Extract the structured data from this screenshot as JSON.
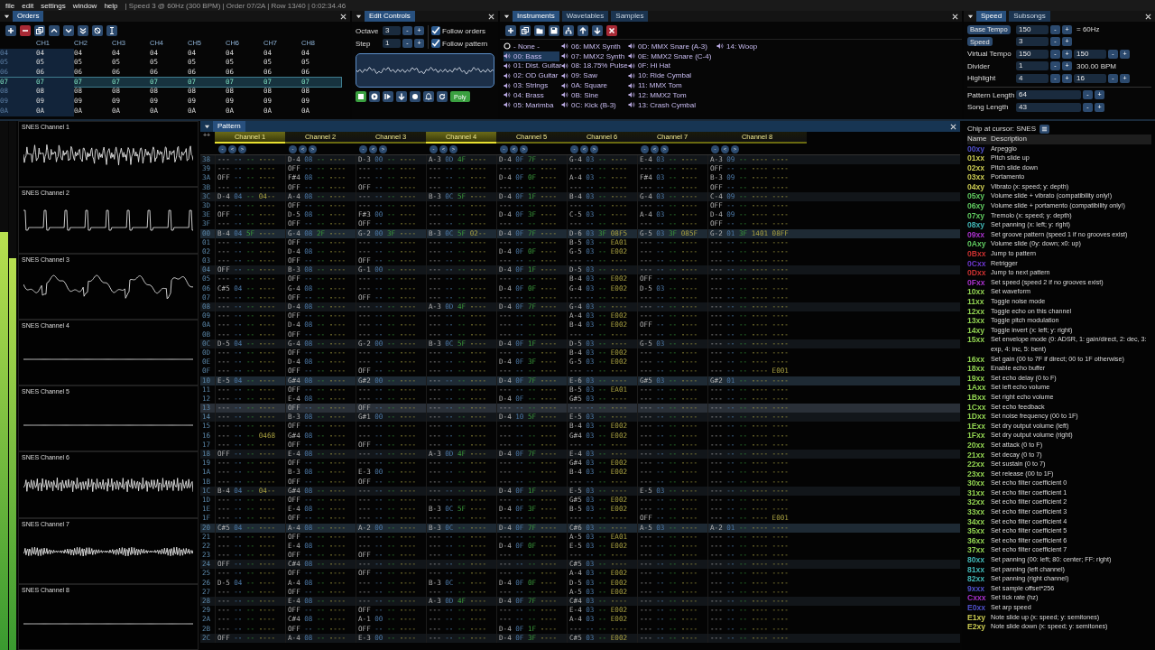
{
  "menu": [
    "file",
    "edit",
    "settings",
    "window",
    "help"
  ],
  "status": "| Speed 3 @ 60Hz (300 BPM) | Order 07/2A | Row 13/40 | 0:02:34.46",
  "orders": {
    "tabs": [
      {
        "label": "Orders",
        "selected": true
      }
    ],
    "toolbar": [
      {
        "kind": "add"
      },
      {
        "kind": "remove"
      },
      {
        "kind": "duplicate"
      },
      {
        "kind": "up"
      },
      {
        "kind": "down"
      },
      {
        "kind": "down-double"
      },
      {
        "kind": "swap"
      },
      {
        "kind": "cursor"
      }
    ],
    "columns": [
      "CH1",
      "CH2",
      "CH3",
      "CH4",
      "CH5",
      "CH6",
      "CH7",
      "CH8"
    ],
    "rows": [
      {
        "label": "04",
        "values": [
          "04",
          "04",
          "04",
          "04",
          "04",
          "04",
          "04",
          "04"
        ],
        "selected": false
      },
      {
        "label": "05",
        "values": [
          "05",
          "05",
          "05",
          "05",
          "05",
          "05",
          "05",
          "05"
        ],
        "selected": false
      },
      {
        "label": "06",
        "values": [
          "06",
          "06",
          "06",
          "06",
          "06",
          "06",
          "06",
          "06"
        ],
        "selected": false
      },
      {
        "label": "07",
        "values": [
          "07",
          "07",
          "07",
          "07",
          "07",
          "07",
          "07",
          "07"
        ],
        "selected": true
      },
      {
        "label": "08",
        "values": [
          "08",
          "08",
          "08",
          "08",
          "08",
          "08",
          "08",
          "08"
        ],
        "selected": false
      },
      {
        "label": "09",
        "values": [
          "09",
          "09",
          "09",
          "09",
          "09",
          "09",
          "09",
          "09"
        ],
        "selected": false
      },
      {
        "label": "0A",
        "values": [
          "0A",
          "0A",
          "0A",
          "0A",
          "0A",
          "0A",
          "0A",
          "0A"
        ],
        "selected": false
      }
    ]
  },
  "edit_controls": {
    "tabs": [
      {
        "label": "Edit Controls",
        "selected": true
      }
    ],
    "fields": [
      {
        "label": "Octave",
        "value": "3",
        "buttons": [
          "-",
          "+"
        ]
      },
      {
        "label": "Step",
        "value": "1",
        "buttons": [
          "-",
          "+"
        ]
      }
    ],
    "toggles": [
      {
        "label": "Follow orders",
        "checked": true
      },
      {
        "label": "Follow pattern",
        "checked": true
      }
    ],
    "transport": [
      {
        "kind": "stop",
        "active": true
      },
      {
        "kind": "play",
        "active": false
      },
      {
        "kind": "step",
        "active": false
      },
      {
        "kind": "down",
        "active": false
      },
      {
        "kind": "record",
        "active": false
      },
      {
        "kind": "bell",
        "active": false
      },
      {
        "kind": "repeat",
        "active": false
      }
    ],
    "poly": {
      "label": "Poly",
      "on": true
    }
  },
  "instruments": {
    "tabs": [
      {
        "label": "Instruments",
        "selected": true
      },
      {
        "label": "Wavetables",
        "selected": false
      },
      {
        "label": "Samples",
        "selected": false
      }
    ],
    "toolbar": [
      {
        "kind": "add"
      },
      {
        "kind": "duplicate"
      },
      {
        "kind": "open"
      },
      {
        "kind": "save"
      },
      {
        "kind": "tree"
      },
      {
        "kind": "up-arrow"
      },
      {
        "kind": "down-arrow"
      },
      {
        "kind": "delete"
      }
    ],
    "items": [
      {
        "kind": "none",
        "label": "- None -",
        "selected": false
      },
      {
        "kind": "instrument",
        "label": "00: Bass",
        "selected": true
      },
      {
        "kind": "instrument",
        "label": "01: Dist. Guitar",
        "selected": false
      },
      {
        "kind": "instrument",
        "label": "02: OD Guitar",
        "selected": false
      },
      {
        "kind": "instrument",
        "label": "03: Strings",
        "selected": false
      },
      {
        "kind": "instrument",
        "label": "04: Brass",
        "selected": false
      },
      {
        "kind": "instrument",
        "label": "05: Marimba",
        "selected": false
      },
      {
        "kind": "instrument",
        "label": "06: MMX Synth",
        "selected": false
      },
      {
        "kind": "instrument",
        "label": "07: MMX2 Synth",
        "selected": false
      },
      {
        "kind": "instrument",
        "label": "08: 18.75% Pulse",
        "selected": false
      },
      {
        "kind": "instrument",
        "label": "09: Saw",
        "selected": false
      },
      {
        "kind": "instrument",
        "label": "0A: Square",
        "selected": false
      },
      {
        "kind": "instrument",
        "label": "0B: Sine",
        "selected": false
      },
      {
        "kind": "instrument",
        "label": "0C: Kick (B-3)",
        "selected": false
      },
      {
        "kind": "instrument",
        "label": "0D: MMX Snare (A-3)",
        "selected": false
      },
      {
        "kind": "instrument",
        "label": "0E: MMX2 Snare (C-4)",
        "selected": false
      },
      {
        "kind": "instrument",
        "label": "0F: Hi Hat",
        "selected": false
      },
      {
        "kind": "instrument",
        "label": "10: Ride Cymbal",
        "selected": false
      },
      {
        "kind": "instrument",
        "label": "11: MMX Tom",
        "selected": false
      },
      {
        "kind": "instrument",
        "label": "12: MMX2 Tom",
        "selected": false
      },
      {
        "kind": "instrument",
        "label": "13: Crash Cymbal",
        "selected": false
      },
      {
        "kind": "instrument",
        "label": "14: Woop",
        "selected": false
      }
    ]
  },
  "speed": {
    "tabs": [
      {
        "label": "Speed",
        "selected": true
      },
      {
        "label": "Subsongs",
        "selected": false
      }
    ],
    "rows": [
      {
        "kind": "button",
        "label": "Base Tempo",
        "value": "150",
        "buttons": [
          "-",
          "+"
        ],
        "note": "= 60Hz"
      },
      {
        "kind": "button",
        "label": "Speed",
        "value": "3",
        "buttons": [
          "-",
          "+"
        ]
      },
      {
        "kind": "text",
        "label": "Virtual Tempo",
        "value": "150",
        "buttons": [
          "-",
          "+"
        ],
        "value2": "150",
        "buttons2": [
          "-",
          "+"
        ]
      },
      {
        "kind": "text",
        "label": "Divider",
        "value": "1",
        "buttons": [
          "-",
          "+"
        ],
        "note": "300.00 BPM"
      },
      {
        "kind": "text",
        "label": "Highlight",
        "value": "4",
        "buttons": [
          "-",
          "+"
        ],
        "value2": "16",
        "buttons2": [
          "-",
          "+"
        ]
      }
    ],
    "lengths": [
      {
        "label": "Pattern Length",
        "value": "64",
        "buttons": [
          "-",
          "+"
        ]
      },
      {
        "label": "Song Length",
        "value": "43",
        "buttons": [
          "-",
          "+"
        ]
      }
    ]
  },
  "vu_meters": [
    {
      "level": 0.79
    },
    {
      "level": 0.74
    }
  ],
  "oscilloscopes": [
    {
      "title": "SNES Channel 1"
    },
    {
      "title": "SNES Channel 2"
    },
    {
      "title": "SNES Channel 3"
    },
    {
      "title": "SNES Channel 4"
    },
    {
      "title": "SNES Channel 5"
    },
    {
      "title": "SNES Channel 6"
    },
    {
      "title": "SNES Channel 7"
    },
    {
      "title": "SNES Channel 8"
    }
  ],
  "pattern": {
    "tabs": [
      {
        "label": "Pattern",
        "selected": true
      }
    ],
    "corner": "++",
    "channels": [
      {
        "name": "Channel 1",
        "active": true,
        "buttons": [
          "-",
          "<",
          ">"
        ]
      },
      {
        "name": "Channel 2",
        "active": false,
        "buttons": [
          "-",
          "<",
          ">"
        ]
      },
      {
        "name": "Channel 3",
        "active": false,
        "buttons": [
          "-",
          "<",
          ">"
        ]
      },
      {
        "name": "Channel 4",
        "active": true,
        "buttons": [
          "-",
          "<",
          ">"
        ]
      },
      {
        "name": "Channel 5",
        "active": false,
        "buttons": [
          "-",
          "<",
          ">"
        ]
      },
      {
        "name": "Channel 6",
        "active": false,
        "buttons": [
          "-",
          "<",
          ">"
        ]
      },
      {
        "name": "Channel 7",
        "active": false,
        "buttons": [
          "-",
          "<",
          ">"
        ]
      },
      {
        "name": "Channel 8",
        "active": false,
        "buttons": [
          "-",
          "<",
          ">"
        ]
      }
    ],
    "rows": [
      {
        "label": "38",
        "selected": false,
        "cells": [
          "--- -- -- ----",
          "D-4 08 -- ----",
          "D-3 00 -- ----",
          "A-3 0D 4F ----",
          "D-4 0F 7F ----",
          "G-4 03 -- ----",
          "E-4 03 -- ----",
          "A-3 09 -- ---- ----"
        ]
      },
      {
        "label": "39",
        "selected": false,
        "cells": [
          "--- -- -- ----",
          "OFF -- -- ----",
          "--- -- -- ----",
          "--- -- -- ----",
          "--- -- -- ----",
          "--- -- -- ----",
          "--- -- -- ----",
          "OFF -- -- ---- ----"
        ]
      },
      {
        "label": "3A",
        "selected": false,
        "cells": [
          "OFF -- -- ----",
          "F#4 08 -- ----",
          "--- -- -- ----",
          "--- -- -- ----",
          "D-4 0F 0F ----",
          "A-4 03 -- ----",
          "F#4 03 -- ----",
          "B-3 09 -- ---- ----"
        ]
      },
      {
        "label": "3B",
        "selected": false,
        "cells": [
          "--- -- -- ----",
          "OFF -- -- ----",
          "OFF -- -- ----",
          "--- -- -- ----",
          "--- -- -- ----",
          "--- -- -- ----",
          "--- -- -- ----",
          "OFF -- -- ---- ----"
        ]
      },
      {
        "label": "3C",
        "selected": false,
        "cells": [
          "D-4 04 -- 04--",
          "A-4 08 -- ----",
          "--- -- -- ----",
          "B-3 0C 5F ----",
          "D-4 0F 1F ----",
          "B-4 03 -- ----",
          "G-4 03 -- ----",
          "C-4 09 -- ---- ----"
        ]
      },
      {
        "label": "3D",
        "selected": false,
        "cells": [
          "--- -- -- ----",
          "OFF -- -- ----",
          "--- -- -- ----",
          "--- -- -- ----",
          "--- -- -- ----",
          "--- -- -- ----",
          "--- -- -- ----",
          "OFF -- -- ---- ----"
        ]
      },
      {
        "label": "3E",
        "selected": false,
        "cells": [
          "OFF -- -- ----",
          "D-5 08 -- ----",
          "F#3 00 -- ----",
          "--- -- -- ----",
          "D-4 0F 3F ----",
          "C-5 03 -- ----",
          "A-4 03 -- ----",
          "D-4 09 -- ---- ----"
        ]
      },
      {
        "label": "3F",
        "selected": false,
        "cells": [
          "--- -- -- ----",
          "OFF -- -- ----",
          "OFF -- -- ----",
          "--- -- -- ----",
          "--- -- -- ----",
          "--- -- -- ----",
          "--- -- -- ----",
          "OFF -- -- ---- ----"
        ]
      },
      {
        "label": "00",
        "selected": false,
        "cells": [
          "B-4 04 5F ----",
          "G-4 08 2F ----",
          "G-2 00 3F ----",
          "B-3 0C 5F 02--",
          "D-4 0F 7F ----",
          "D-6 03 3F 08F5",
          "G-5 03 3F 085F",
          "G-2 01 3F 1401 08FF"
        ]
      },
      {
        "label": "01",
        "selected": false,
        "cells": [
          "--- -- -- ----",
          "OFF -- -- ----",
          "--- -- -- ----",
          "--- -- -- ----",
          "--- -- -- ----",
          "B-5 03 -- EA01",
          "--- -- -- ----",
          "--- -- -- ---- ----"
        ]
      },
      {
        "label": "02",
        "selected": false,
        "cells": [
          "--- -- -- ----",
          "D-4 08 -- ----",
          "--- -- -- ----",
          "--- -- -- ----",
          "D-4 0F 0F ----",
          "G-5 03 -- E002",
          "--- -- -- ----",
          "--- -- -- ---- ----"
        ]
      },
      {
        "label": "03",
        "selected": false,
        "cells": [
          "--- -- -- ----",
          "OFF -- -- ----",
          "OFF -- -- ----",
          "--- -- -- ----",
          "--- -- -- ----",
          "--- -- -- ----",
          "--- -- -- ----",
          "--- -- -- ---- ----"
        ]
      },
      {
        "label": "04",
        "selected": false,
        "cells": [
          "OFF -- -- ----",
          "B-3 08 -- ----",
          "G-1 00 -- ----",
          "--- -- -- ----",
          "D-4 0F 1F ----",
          "D-5 03 -- ----",
          "--- -- -- ----",
          "--- -- -- ---- ----"
        ]
      },
      {
        "label": "05",
        "selected": false,
        "cells": [
          "--- -- -- ----",
          "OFF -- -- ----",
          "--- -- -- ----",
          "--- -- -- ----",
          "--- -- -- ----",
          "B-4 03 -- E002",
          "OFF -- -- ----",
          "--- -- -- ---- ----"
        ]
      },
      {
        "label": "06",
        "selected": false,
        "cells": [
          "C#5 04 -- ----",
          "G-4 08 -- ----",
          "--- -- -- ----",
          "--- -- -- ----",
          "D-4 0F 0F ----",
          "G-4 03 -- E002",
          "D-5 03 -- ----",
          "--- -- -- ---- ----"
        ]
      },
      {
        "label": "07",
        "selected": false,
        "cells": [
          "--- -- -- ----",
          "OFF -- -- ----",
          "OFF -- -- ----",
          "--- -- -- ----",
          "--- -- -- ----",
          "--- -- -- ----",
          "--- -- -- ----",
          "--- -- -- ---- ----"
        ]
      },
      {
        "label": "08",
        "selected": false,
        "cells": [
          "--- -- -- ----",
          "D-4 08 -- ----",
          "--- -- -- ----",
          "A-3 0D 4F ----",
          "D-4 0F 7F ----",
          "G-4 03 -- ----",
          "--- -- -- ----",
          "--- -- -- ---- ----"
        ]
      },
      {
        "label": "09",
        "selected": false,
        "cells": [
          "--- -- -- ----",
          "OFF -- -- ----",
          "--- -- -- ----",
          "--- -- -- ----",
          "--- -- -- ----",
          "A-4 03 -- E002",
          "--- -- -- ----",
          "--- -- -- ---- ----"
        ]
      },
      {
        "label": "0A",
        "selected": false,
        "cells": [
          "--- -- -- ----",
          "D-4 08 -- ----",
          "--- -- -- ----",
          "--- -- -- ----",
          "--- -- -- ----",
          "B-4 03 -- E002",
          "OFF -- -- ----",
          "--- -- -- ---- ----"
        ]
      },
      {
        "label": "0B",
        "selected": false,
        "cells": [
          "--- -- -- ----",
          "OFF -- -- ----",
          "--- -- -- ----",
          "--- -- -- ----",
          "--- -- -- ----",
          "--- -- -- ----",
          "--- -- -- ----",
          "--- -- -- ---- ----"
        ]
      },
      {
        "label": "0C",
        "selected": false,
        "cells": [
          "D-5 04 -- ----",
          "G-4 08 -- ----",
          "G-2 00 -- ----",
          "B-3 0C 5F ----",
          "D-4 0F 1F ----",
          "D-5 03 -- ----",
          "G-5 03 -- ----",
          "--- -- -- ---- ----"
        ]
      },
      {
        "label": "0D",
        "selected": false,
        "cells": [
          "--- -- -- ----",
          "OFF -- -- ----",
          "--- -- -- ----",
          "--- -- -- ----",
          "--- -- -- ----",
          "B-4 03 -- E002",
          "--- -- -- ----",
          "--- -- -- ---- ----"
        ]
      },
      {
        "label": "0E",
        "selected": false,
        "cells": [
          "--- -- -- ----",
          "D-4 08 -- ----",
          "--- -- -- ----",
          "--- -- -- ----",
          "D-4 0F 3F ----",
          "G-5 03 -- E002",
          "--- -- -- ----",
          "--- -- -- ---- ----"
        ]
      },
      {
        "label": "0F",
        "selected": false,
        "cells": [
          "--- -- -- ----",
          "OFF -- -- ----",
          "OFF -- -- ----",
          "--- -- -- ----",
          "--- -- -- ----",
          "--- -- -- ----",
          "--- -- -- ----",
          "--- -- -- ---- E001"
        ]
      },
      {
        "label": "10",
        "selected": false,
        "cells": [
          "E-5 04 -- ----",
          "G#4 08 -- ----",
          "G#2 00 -- ----",
          "--- -- -- ----",
          "D-4 0F 7F ----",
          "E-6 03 -- ----",
          "G#5 03 -- ----",
          "G#2 01 -- ---- ----"
        ]
      },
      {
        "label": "11",
        "selected": false,
        "cells": [
          "--- -- -- ----",
          "OFF -- -- ----",
          "--- -- -- ----",
          "--- -- -- ----",
          "--- -- -- ----",
          "B-5 03 -- EA01",
          "--- -- -- ----",
          "--- -- -- ---- ----"
        ]
      },
      {
        "label": "12",
        "selected": false,
        "cells": [
          "--- -- -- ----",
          "E-4 08 -- ----",
          "--- -- -- ----",
          "--- -- -- ----",
          "D-4 0F -- ----",
          "G#5 03 -- ----",
          "--- -- -- ----",
          "--- -- -- ---- ----"
        ]
      },
      {
        "label": "13",
        "selected": true,
        "cells": [
          "--- -- -- ----",
          "OFF -- -- ----",
          "OFF -- -- ----",
          "--- -- -- ----",
          "--- -- -- ----",
          "--- -- -- ----",
          "--- -- -- ----",
          "--- -- -- ---- ----"
        ]
      },
      {
        "label": "14",
        "selected": false,
        "cells": [
          "--- -- -- ----",
          "B-3 08 -- ----",
          "G#1 00 -- ----",
          "--- -- -- ----",
          "D-4 10 5F ----",
          "E-5 03 -- ----",
          "--- -- -- ----",
          "--- -- -- ---- ----"
        ]
      },
      {
        "label": "15",
        "selected": false,
        "cells": [
          "--- -- -- ----",
          "OFF -- -- ----",
          "--- -- -- ----",
          "--- -- -- ----",
          "--- -- -- ----",
          "B-4 03 -- E002",
          "--- -- -- ----",
          "--- -- -- ---- ----"
        ]
      },
      {
        "label": "16",
        "selected": false,
        "cells": [
          "--- -- -- 0468",
          "G#4 08 -- ----",
          "--- -- -- ----",
          "--- -- -- ----",
          "--- -- -- ----",
          "G#4 03 -- E002",
          "--- -- -- ----",
          "--- -- -- ---- ----"
        ]
      },
      {
        "label": "17",
        "selected": false,
        "cells": [
          "--- -- -- ----",
          "OFF -- -- ----",
          "OFF -- -- ----",
          "--- -- -- ----",
          "--- -- -- ----",
          "--- -- -- ----",
          "--- -- -- ----",
          "--- -- -- ---- ----"
        ]
      },
      {
        "label": "18",
        "selected": false,
        "cells": [
          "OFF -- -- ----",
          "E-4 08 -- ----",
          "--- -- -- ----",
          "A-3 0D 4F ----",
          "D-4 0F 7F ----",
          "E-4 03 -- ----",
          "--- -- -- ----",
          "--- -- -- ---- ----"
        ]
      },
      {
        "label": "19",
        "selected": false,
        "cells": [
          "--- -- -- ----",
          "OFF -- -- ----",
          "--- -- -- ----",
          "--- -- -- ----",
          "--- -- -- ----",
          "G#4 03 -- E002",
          "--- -- -- ----",
          "--- -- -- ---- ----"
        ]
      },
      {
        "label": "1A",
        "selected": false,
        "cells": [
          "--- -- -- ----",
          "B-3 08 -- ----",
          "E-3 00 -- ----",
          "--- -- -- ----",
          "--- -- -- ----",
          "B-4 03 -- E002",
          "--- -- -- ----",
          "--- -- -- ---- ----"
        ]
      },
      {
        "label": "1B",
        "selected": false,
        "cells": [
          "--- -- -- ----",
          "OFF -- -- ----",
          "OFF -- -- ----",
          "--- -- -- ----",
          "--- -- -- ----",
          "--- -- -- ----",
          "--- -- -- ----",
          "--- -- -- ---- ----"
        ]
      },
      {
        "label": "1C",
        "selected": false,
        "cells": [
          "B-4 04 -- 04--",
          "G#4 08 -- ----",
          "--- -- -- ----",
          "--- -- -- ----",
          "D-4 0F 1F ----",
          "E-5 03 -- ----",
          "E-5 03 -- ----",
          "--- -- -- ---- ----"
        ]
      },
      {
        "label": "1D",
        "selected": false,
        "cells": [
          "--- -- -- ----",
          "OFF -- -- ----",
          "--- -- -- ----",
          "--- -- -- ----",
          "--- -- -- ----",
          "G#5 03 -- E002",
          "--- -- -- ----",
          "--- -- -- ---- ----"
        ]
      },
      {
        "label": "1E",
        "selected": false,
        "cells": [
          "--- -- -- ----",
          "E-4 08 -- ----",
          "--- -- -- ----",
          "B-3 0C 5F ----",
          "D-4 0F 3F ----",
          "B-5 03 -- E002",
          "--- -- -- ----",
          "--- -- -- ---- ----"
        ]
      },
      {
        "label": "1F",
        "selected": false,
        "cells": [
          "--- -- -- ----",
          "OFF -- -- ----",
          "--- -- -- ----",
          "--- -- -- ----",
          "--- -- -- ----",
          "--- -- -- ----",
          "OFF -- -- ----",
          "--- -- -- ---- E001"
        ]
      },
      {
        "label": "20",
        "selected": false,
        "cells": [
          "C#5 04 -- ----",
          "A-4 08 -- ----",
          "A-2 00 -- ----",
          "B-3 0C -- ----",
          "D-4 0F 7F ----",
          "C#6 03 -- ----",
          "A-5 03 -- ----",
          "A-2 01 -- ---- ----"
        ]
      },
      {
        "label": "21",
        "selected": false,
        "cells": [
          "--- -- -- ----",
          "OFF -- -- ----",
          "--- -- -- ----",
          "--- -- -- ----",
          "--- -- -- ----",
          "A-5 03 -- EA01",
          "--- -- -- ----",
          "--- -- -- ---- ----"
        ]
      },
      {
        "label": "22",
        "selected": false,
        "cells": [
          "--- -- -- ----",
          "E-4 08 -- ----",
          "--- -- -- ----",
          "--- -- -- ----",
          "D-4 0F 0F ----",
          "E-5 03 -- E002",
          "--- -- -- ----",
          "--- -- -- ---- ----"
        ]
      },
      {
        "label": "23",
        "selected": false,
        "cells": [
          "--- -- -- ----",
          "OFF -- -- ----",
          "OFF -- -- ----",
          "--- -- -- ----",
          "--- -- -- ----",
          "--- -- -- ----",
          "--- -- -- ----",
          "--- -- -- ---- ----"
        ]
      },
      {
        "label": "24",
        "selected": false,
        "cells": [
          "OFF -- -- ----",
          "C#4 08 -- ----",
          "--- -- -- ----",
          "--- -- -- ----",
          "--- -- -- ----",
          "C#5 03 -- ----",
          "--- -- -- ----",
          "--- -- -- ---- ----"
        ]
      },
      {
        "label": "25",
        "selected": false,
        "cells": [
          "--- -- -- ----",
          "OFF -- -- ----",
          "OFF -- -- ----",
          "--- -- -- ----",
          "--- -- -- ----",
          "A-4 03 -- E002",
          "--- -- -- ----",
          "--- -- -- ---- ----"
        ]
      },
      {
        "label": "26",
        "selected": false,
        "cells": [
          "D-5 04 -- ----",
          "A-4 08 -- ----",
          "--- -- -- ----",
          "B-3 0C -- ----",
          "D-4 0F 0F ----",
          "D-5 03 -- E002",
          "--- -- -- ----",
          "--- -- -- ---- ----"
        ]
      },
      {
        "label": "27",
        "selected": false,
        "cells": [
          "--- -- -- ----",
          "OFF -- -- ----",
          "--- -- -- ----",
          "--- -- -- ----",
          "--- -- -- ----",
          "A-5 03 -- E002",
          "--- -- -- ----",
          "--- -- -- ---- ----"
        ]
      },
      {
        "label": "28",
        "selected": false,
        "cells": [
          "--- -- -- ----",
          "E-4 08 -- ----",
          "--- -- -- ----",
          "A-3 0D 4F ----",
          "D-4 0F 7F ----",
          "C#4 03 -- ----",
          "--- -- -- ----",
          "--- -- -- ---- ----"
        ]
      },
      {
        "label": "29",
        "selected": false,
        "cells": [
          "--- -- -- ----",
          "OFF -- -- ----",
          "OFF -- -- ----",
          "--- -- -- ----",
          "--- -- -- ----",
          "E-4 03 -- E002",
          "--- -- -- ----",
          "--- -- -- ---- ----"
        ]
      },
      {
        "label": "2A",
        "selected": false,
        "cells": [
          "--- -- -- ----",
          "C#4 08 -- ----",
          "A-1 00 -- ----",
          "--- -- -- ----",
          "--- -- -- ----",
          "A-4 03 -- E002",
          "--- -- -- ----",
          "--- -- -- ---- ----"
        ]
      },
      {
        "label": "2B",
        "selected": false,
        "cells": [
          "--- -- -- ----",
          "OFF -- -- ----",
          "OFF -- -- ----",
          "--- -- -- ----",
          "D-4 0F 1F ----",
          "--- -- -- ----",
          "--- -- -- ----",
          "--- -- -- ---- ----"
        ]
      },
      {
        "label": "2C",
        "selected": false,
        "cells": [
          "OFF -- -- ----",
          "A-4 08 -- ----",
          "E-3 00 -- ----",
          "--- -- -- ----",
          "D-4 0F 3F ----",
          "C#5 03 -- E002",
          "--- -- -- ----",
          "--- -- -- ---- ----"
        ]
      }
    ]
  },
  "effects": {
    "chip": "Chip at cursor: SNES",
    "columns": [
      "Name",
      "Description"
    ],
    "items": [
      {
        "code": "00xy",
        "description": "Arpeggio",
        "color": "#4f4fc8"
      },
      {
        "code": "01xx",
        "description": "Pitch slide up",
        "color": "#c8c850"
      },
      {
        "code": "02xx",
        "description": "Pitch slide down",
        "color": "#c8c850"
      },
      {
        "code": "03xx",
        "description": "Portamento",
        "color": "#c8c850"
      },
      {
        "code": "04xy",
        "description": "Vibrato (x: speed; y: depth)",
        "color": "#c8c850"
      },
      {
        "code": "05xy",
        "description": "Volume slide + vibrato (compatibility only!)",
        "color": "#5fc85f"
      },
      {
        "code": "06xy",
        "description": "Volume slide + portamento (compatibility only!)",
        "color": "#5fc85f"
      },
      {
        "code": "07xy",
        "description": "Tremolo (x: speed; y: depth)",
        "color": "#5fc85f"
      },
      {
        "code": "08xy",
        "description": "Set panning (x: left; y: right)",
        "color": "#40b4b4"
      },
      {
        "code": "09xx",
        "description": "Set groove pattern (speed 1 if no grooves exist)",
        "color": "#a630c8"
      },
      {
        "code": "0Axy",
        "description": "Volume slide (0y: down; x0: up)",
        "color": "#5fc85f"
      },
      {
        "code": "0Bxx",
        "description": "Jump to pattern",
        "color": "#c83030"
      },
      {
        "code": "0Cxx",
        "description": "Retrigger",
        "color": "#6a35c8"
      },
      {
        "code": "0Dxx",
        "description": "Jump to next pattern",
        "color": "#c83030"
      },
      {
        "code": "0Fxx",
        "description": "Set speed (speed 2 if no grooves exist)",
        "color": "#a630c8"
      },
      {
        "code": "10xx",
        "description": "Set waveform",
        "color": "#8fd050"
      },
      {
        "code": "11xx",
        "description": "Toggle noise mode",
        "color": "#8fd050"
      },
      {
        "code": "12xx",
        "description": "Toggle echo on this channel",
        "color": "#8fd050"
      },
      {
        "code": "13xx",
        "description": "Toggle pitch modulation",
        "color": "#8fd050"
      },
      {
        "code": "14xy",
        "description": "Toggle invert (x: left; y: right)",
        "color": "#8fd050"
      },
      {
        "code": "15xx",
        "description": "Set envelope mode (0: ADSR, 1: gain/direct, 2: dec, 3: exp, 4: inc, 5: bent)",
        "color": "#8fd050"
      },
      {
        "code": "16xx",
        "description": "Set gain (00 to 7F if direct; 00 to 1F otherwise)",
        "color": "#8fd050"
      },
      {
        "code": "18xx",
        "description": "Enable echo buffer",
        "color": "#8fd050"
      },
      {
        "code": "19xx",
        "description": "Set echo delay (0 to F)",
        "color": "#8fd050"
      },
      {
        "code": "1Axx",
        "description": "Set left echo volume",
        "color": "#8fd050"
      },
      {
        "code": "1Bxx",
        "description": "Set right echo volume",
        "color": "#8fd050"
      },
      {
        "code": "1Cxx",
        "description": "Set echo feedback",
        "color": "#8fd050"
      },
      {
        "code": "1Dxx",
        "description": "Set noise frequency (00 to 1F)",
        "color": "#8fd050"
      },
      {
        "code": "1Exx",
        "description": "Set dry output volume (left)",
        "color": "#8fd050"
      },
      {
        "code": "1Fxx",
        "description": "Set dry output volume (right)",
        "color": "#8fd050"
      },
      {
        "code": "20xx",
        "description": "Set attack (0 to F)",
        "color": "#8fd050"
      },
      {
        "code": "21xx",
        "description": "Set decay (0 to 7)",
        "color": "#8fd050"
      },
      {
        "code": "22xx",
        "description": "Set sustain (0 to 7)",
        "color": "#8fd050"
      },
      {
        "code": "23xx",
        "description": "Set release (00 to 1F)",
        "color": "#8fd050"
      },
      {
        "code": "30xx",
        "description": "Set echo filter coefficient 0",
        "color": "#8fd050"
      },
      {
        "code": "31xx",
        "description": "Set echo filter coefficient 1",
        "color": "#8fd050"
      },
      {
        "code": "32xx",
        "description": "Set echo filter coefficient 2",
        "color": "#8fd050"
      },
      {
        "code": "33xx",
        "description": "Set echo filter coefficient 3",
        "color": "#8fd050"
      },
      {
        "code": "34xx",
        "description": "Set echo filter coefficient 4",
        "color": "#8fd050"
      },
      {
        "code": "35xx",
        "description": "Set echo filter coefficient 5",
        "color": "#8fd050"
      },
      {
        "code": "36xx",
        "description": "Set echo filter coefficient 6",
        "color": "#8fd050"
      },
      {
        "code": "37xx",
        "description": "Set echo filter coefficient 7",
        "color": "#8fd050"
      },
      {
        "code": "80xx",
        "description": "Set panning (00: left; 80: center; FF: right)",
        "color": "#40b4b4"
      },
      {
        "code": "81xx",
        "description": "Set panning (left channel)",
        "color": "#40b4b4"
      },
      {
        "code": "82xx",
        "description": "Set panning (right channel)",
        "color": "#40b4b4"
      },
      {
        "code": "9xxx",
        "description": "Set sample offset*256",
        "color": "#4f4fc8"
      },
      {
        "code": "Cxxx",
        "description": "Set tick rate (hz)",
        "color": "#a630c8"
      },
      {
        "code": "E0xx",
        "description": "Set arp speed",
        "color": "#4f4fc8"
      },
      {
        "code": "E1xy",
        "description": "Note slide up (x: speed; y: semitones)",
        "color": "#c8c850"
      },
      {
        "code": "E2xy",
        "description": "Note slide down (x: speed; y: semitones)",
        "color": "#c8c850"
      }
    ]
  }
}
